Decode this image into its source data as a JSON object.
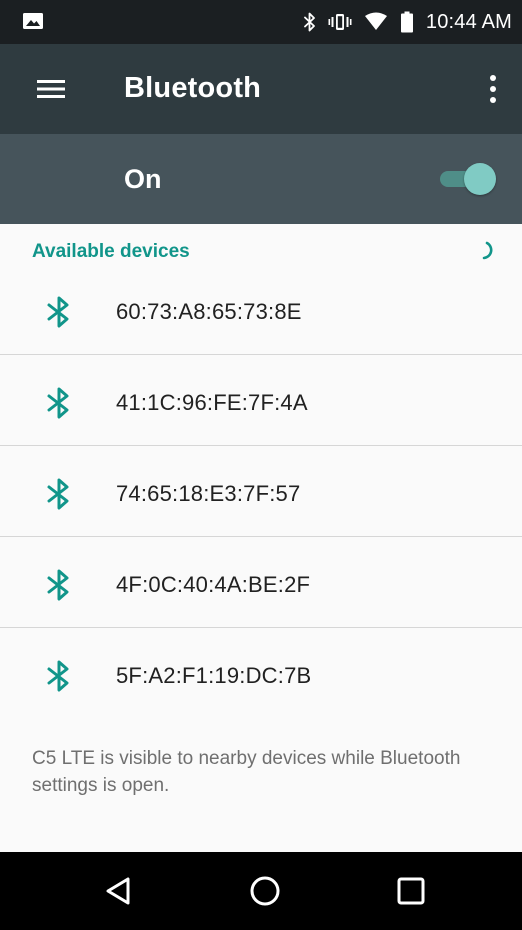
{
  "status_bar": {
    "time": "10:44 AM",
    "icons": [
      "image-icon",
      "bluetooth-status-icon",
      "vibrate-icon",
      "wifi-icon",
      "battery-icon"
    ]
  },
  "app_bar": {
    "title": "Bluetooth",
    "menu_icon": "hamburger-menu-icon",
    "overflow_icon": "more-vert-icon"
  },
  "master_switch": {
    "label": "On",
    "checked": true
  },
  "available_devices": {
    "title": "Available devices",
    "progress_icon": "scanning-spinner-icon",
    "devices": [
      {
        "name": "60:73:A8:65:73:8E",
        "icon": "bluetooth-icon"
      },
      {
        "name": "41:1C:96:FE:7F:4A",
        "icon": "bluetooth-icon"
      },
      {
        "name": "74:65:18:E3:7F:57",
        "icon": "bluetooth-icon"
      },
      {
        "name": "4F:0C:40:4A:BE:2F",
        "icon": "bluetooth-icon"
      },
      {
        "name": "5F:A2:F1:19:DC:7B",
        "icon": "bluetooth-icon"
      }
    ]
  },
  "footer": {
    "note": "C5 LTE is visible to nearby devices while Bluetooth settings is open."
  },
  "nav_bar": {
    "icons": [
      "back-icon",
      "home-icon",
      "recents-icon"
    ]
  },
  "colors": {
    "status_bar": "#1b1f22",
    "app_bar": "#2f3b40",
    "switch_bar": "#46545b",
    "accent": "#11958a",
    "toggle_thumb": "#80cbc4",
    "nav_bar": "#000000"
  }
}
